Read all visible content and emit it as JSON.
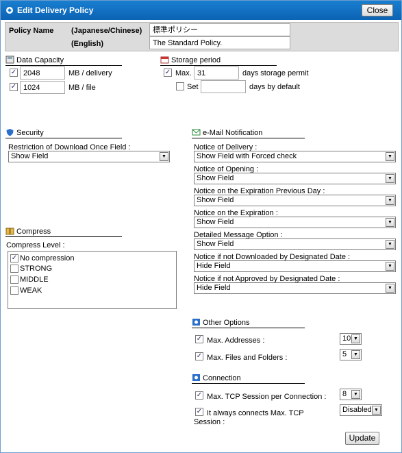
{
  "window": {
    "title": "Edit Delivery Policy",
    "close_label": "Close"
  },
  "policy": {
    "name_label": "Policy Name",
    "jp_label": "(Japanese/Chinese)",
    "en_label": "(English)",
    "jp_value": "標準ポリシー",
    "en_value": "The Standard Policy."
  },
  "data_capacity": {
    "heading": "Data Capacity",
    "delivery_value": "2048",
    "delivery_unit": "MB / delivery",
    "file_value": "1024",
    "file_unit": "MB / file"
  },
  "storage": {
    "heading": "Storage period",
    "max_label": "Max.",
    "max_value": "31",
    "max_suffix": "days storage permit",
    "set_label": "Set",
    "set_value": "",
    "set_suffix": "days by default"
  },
  "security": {
    "heading": "Security",
    "restriction_label": "Restriction of Download Once Field :",
    "restriction_value": "Show Field"
  },
  "compress": {
    "heading": "Compress",
    "level_label": "Compress Level :",
    "options": [
      "No compression",
      "STRONG",
      "MIDDLE",
      "WEAK"
    ]
  },
  "email": {
    "heading": "e-Mail Notification",
    "fields": [
      {
        "label": "Notice of Delivery :",
        "value": "Show Field with Forced check"
      },
      {
        "label": "Notice of Opening :",
        "value": "Show Field"
      },
      {
        "label": "Notice on the Expiration Previous Day :",
        "value": "Show Field"
      },
      {
        "label": "Notice on the Expiration :",
        "value": "Show Field"
      },
      {
        "label": "Detailed Message Option :",
        "value": "Show Field"
      },
      {
        "label": "Notice if not Downloaded by Designated Date :",
        "value": "Hide Field"
      },
      {
        "label": "Notice if not Approved by Designated Date :",
        "value": "Hide Field"
      }
    ]
  },
  "other": {
    "heading": "Other Options",
    "max_addresses_label": "Max. Addresses :",
    "max_addresses_value": "10",
    "max_files_label": "Max. Files and Folders :",
    "max_files_value": "5"
  },
  "connection": {
    "heading": "Connection",
    "max_tcp_label": "Max. TCP Session per Connection :",
    "max_tcp_value": "8",
    "always_label_1": "It always connects Max. TCP",
    "always_label_2": "Session :",
    "always_value": "Disabled"
  },
  "update_label": "Update",
  "checkmark": "✓",
  "arrow": "▼"
}
